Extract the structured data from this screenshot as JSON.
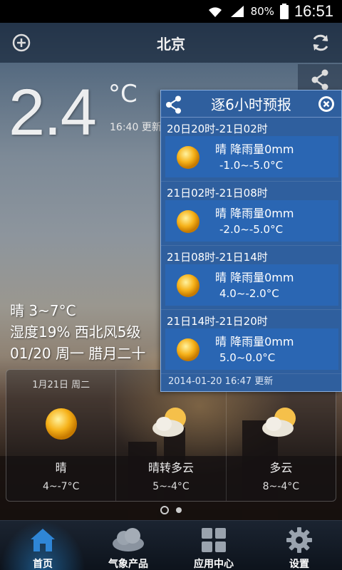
{
  "status_bar": {
    "battery": "80%",
    "time": "16:51",
    "icons": [
      "wifi-icon",
      "signal-icon",
      "battery-icon"
    ]
  },
  "header": {
    "city": "北京",
    "left_icon": "add-icon",
    "right_icon": "refresh-icon"
  },
  "current": {
    "temp": "2.4",
    "unit": "°C",
    "update_time": "16:40 更新",
    "condition_line": "晴  3~7°C",
    "humidity_wind": "湿度19%  西北风5级",
    "date_line": "01/20  周一  腊月二十"
  },
  "forecast": [
    {
      "date": "1月21日 周二",
      "icon": "sunny-icon",
      "condition": "晴",
      "range": "4~-7°C"
    },
    {
      "date": "1月2",
      "icon": "partly-cloudy-icon",
      "condition": "晴转多云",
      "range": "5~-4°C"
    },
    {
      "date": "",
      "icon": "partly-cloudy-icon",
      "condition": "多云",
      "range": "8~-4°C"
    }
  ],
  "bottom_nav": [
    {
      "label": "首页",
      "icon": "home-icon",
      "active": true
    },
    {
      "label": "气象产品",
      "icon": "cloud-icon",
      "active": false
    },
    {
      "label": "应用中心",
      "icon": "grid-icon",
      "active": false
    },
    {
      "label": "设置",
      "icon": "gear-icon",
      "active": false
    }
  ],
  "popup": {
    "title": "逐6小时预报",
    "periods": [
      {
        "time": "20日20时-21日02时",
        "condition": "晴 降雨量0mm",
        "range": "-1.0~-5.0°C"
      },
      {
        "time": "21日02时-21日08时",
        "condition": "晴 降雨量0mm",
        "range": "-2.0~-5.0°C"
      },
      {
        "time": "21日08时-21日14时",
        "condition": "晴 降雨量0mm",
        "range": "4.0~-2.0°C"
      },
      {
        "time": "21日14时-21日20时",
        "condition": "晴 降雨量0mm",
        "range": "5.0~0.0°C"
      }
    ],
    "footer": "2014-01-20 16:47 更新"
  }
}
